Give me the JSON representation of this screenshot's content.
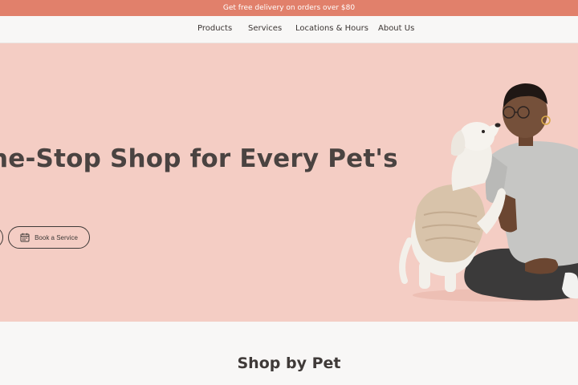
{
  "promo": {
    "text": "Get free delivery on orders over $80"
  },
  "nav": {
    "items": [
      {
        "label": "Products"
      },
      {
        "label": "Services"
      },
      {
        "label": "Locations & Hours"
      },
      {
        "label": "About Us"
      }
    ]
  },
  "hero": {
    "title": "he-Stop Shop for Every Pet's",
    "book_button_label": "Book a Service"
  },
  "shop": {
    "title": "Shop by Pet"
  },
  "colors": {
    "promo_bg": "#e1806b",
    "hero_bg": "#f4cdc4",
    "page_bg": "#f8f7f6",
    "text_dark": "#3f3a38"
  },
  "icons": {
    "book_button": "calendar-icon"
  }
}
